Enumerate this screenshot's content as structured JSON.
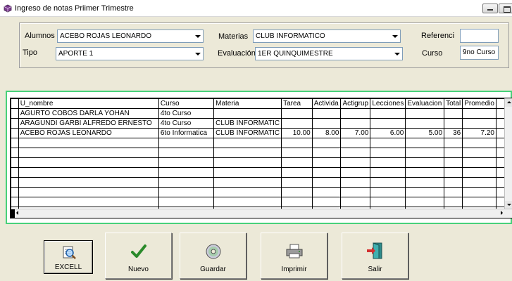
{
  "window": {
    "title": "Ingreso de notas Priimer Trimestre"
  },
  "filters": {
    "alumnos_label": "Alumnos",
    "alumnos_value": "ACEBO ROJAS LEONARDO",
    "tipo_label": "Tipo",
    "tipo_value": "APORTE 1",
    "materias_label": "Materias",
    "materias_value": "CLUB INFORMATICO",
    "evaluacion_label": "Evaluación",
    "evaluacion_value": "1ER QUINQUIMESTRE",
    "referencia_label": "Referenci",
    "referencia_value": "",
    "curso_label": "Curso",
    "curso_value": "9no Curso"
  },
  "grid": {
    "columns": [
      "U_nombre",
      "Curso",
      "Materia",
      "Tarea",
      "Activida",
      "Actigrup",
      "Lecciones",
      "Evaluacion",
      "Total",
      "Promedio"
    ],
    "rows": [
      [
        "AGURTO COBOS DARLA YOHAN",
        "4to Curso",
        "",
        "",
        "",
        "",
        "",
        "",
        "",
        ""
      ],
      [
        "ARAGUNDI GARBI ALFREDO ERNESTO",
        "4to Curso",
        "CLUB INFORMATIC",
        "",
        "",
        "",
        "",
        "",
        "",
        ""
      ],
      [
        "ACEBO ROJAS LEONARDO",
        "6to Informatica",
        "CLUB INFORMATIC",
        "10.00",
        "8.00",
        "7.00",
        "6.00",
        "5.00",
        "36",
        "7.20"
      ]
    ],
    "empty_rows": 8
  },
  "buttons": {
    "excel": "EXCELL",
    "nuevo": "Nuevo",
    "guardar": "Guardar",
    "imprimir": "Imprimir",
    "salir": "Salir"
  },
  "colors": {
    "grid_frame": "#47d17a",
    "check": "#2a8a2a"
  }
}
